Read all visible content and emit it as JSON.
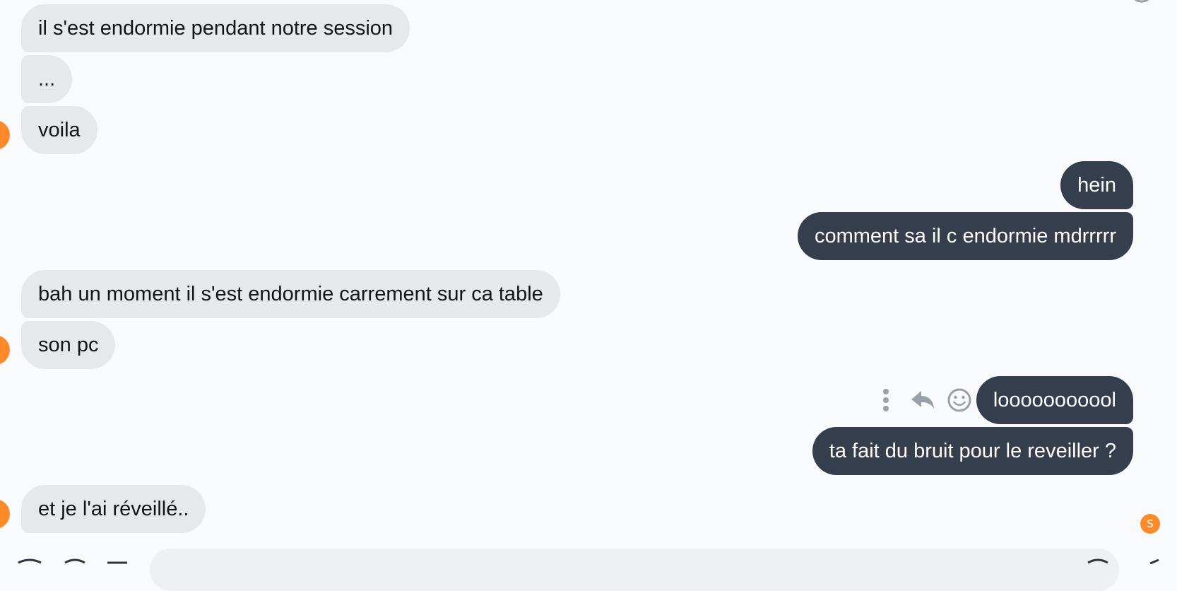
{
  "messages": [
    {
      "sender": "other",
      "text": "il s'est endormie pendant notre session"
    },
    {
      "sender": "other",
      "text": "..."
    },
    {
      "sender": "other",
      "text": "voila"
    },
    {
      "sender": "me",
      "text": "hein"
    },
    {
      "sender": "me",
      "text": "comment sa il c endormie mdrrrrr"
    },
    {
      "sender": "other",
      "text": "bah un moment il s'est endormie carrement sur ca table"
    },
    {
      "sender": "other",
      "text": "son pc"
    },
    {
      "sender": "me",
      "text": "looooooooool"
    },
    {
      "sender": "me",
      "text": "ta fait du bruit pour le reveiller ?"
    },
    {
      "sender": "other",
      "text": "et je l'ai réveillé.."
    }
  ],
  "seen_indicator": {
    "initial": "S"
  },
  "message_actions": {
    "icons": [
      "more-options-icon",
      "reply-icon",
      "react-emoji-icon"
    ]
  },
  "colors": {
    "incoming_bubble": "#e7e8ec",
    "outgoing_bubble": "#353e4c",
    "avatar_accent": "#ff8a2a",
    "background": "#f9fafb"
  }
}
